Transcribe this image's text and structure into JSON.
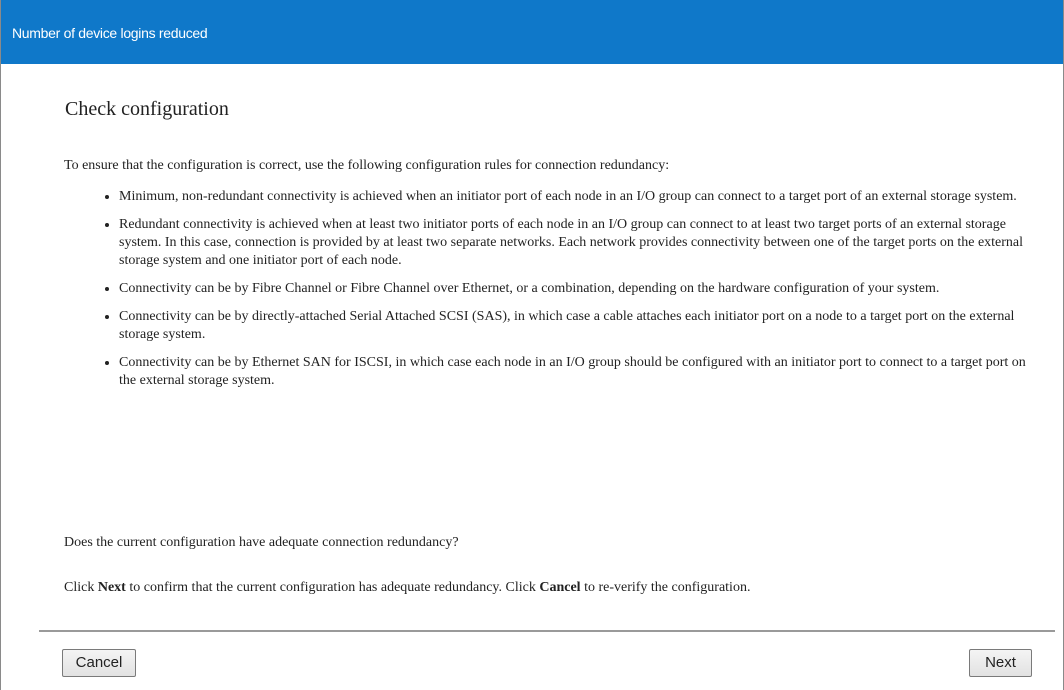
{
  "window": {
    "title": "Number of device logins reduced"
  },
  "main": {
    "heading": "Check configuration",
    "intro": "To ensure that the configuration is correct, use the following configuration rules for connection redundancy:",
    "rules": [
      "Minimum, non-redundant connectivity is achieved when an initiator port of each node in an I/O group can connect to a target port of an external storage system.",
      "Redundant connectivity is achieved when at least two initiator ports of each node in an I/O group can connect to at least two target ports of an external storage system. In this case, connection is provided by at least two separate networks. Each network provides connectivity between one of the target ports on the external storage system and one initiator port of each node.",
      "Connectivity can be by Fibre Channel or Fibre Channel over Ethernet, or a combination, depending on the hardware configuration of your system.",
      "Connectivity can be by directly-attached Serial Attached SCSI (SAS), in which case a cable attaches each initiator port on a node to a target port on the external storage system.",
      "Connectivity can be by Ethernet SAN for ISCSI, in which case each node in an I/O group should be configured with an initiator port to connect to a target port on the external storage system."
    ],
    "question": "Does the current configuration have adequate connection redundancy?",
    "instruction": {
      "part1": "Click ",
      "next_word": "Next",
      "part2": " to confirm that the current configuration has adequate redundancy. Click ",
      "cancel_word": "Cancel",
      "part3": " to re-verify the configuration."
    }
  },
  "footer": {
    "cancel_label": "Cancel",
    "next_label": "Next"
  }
}
